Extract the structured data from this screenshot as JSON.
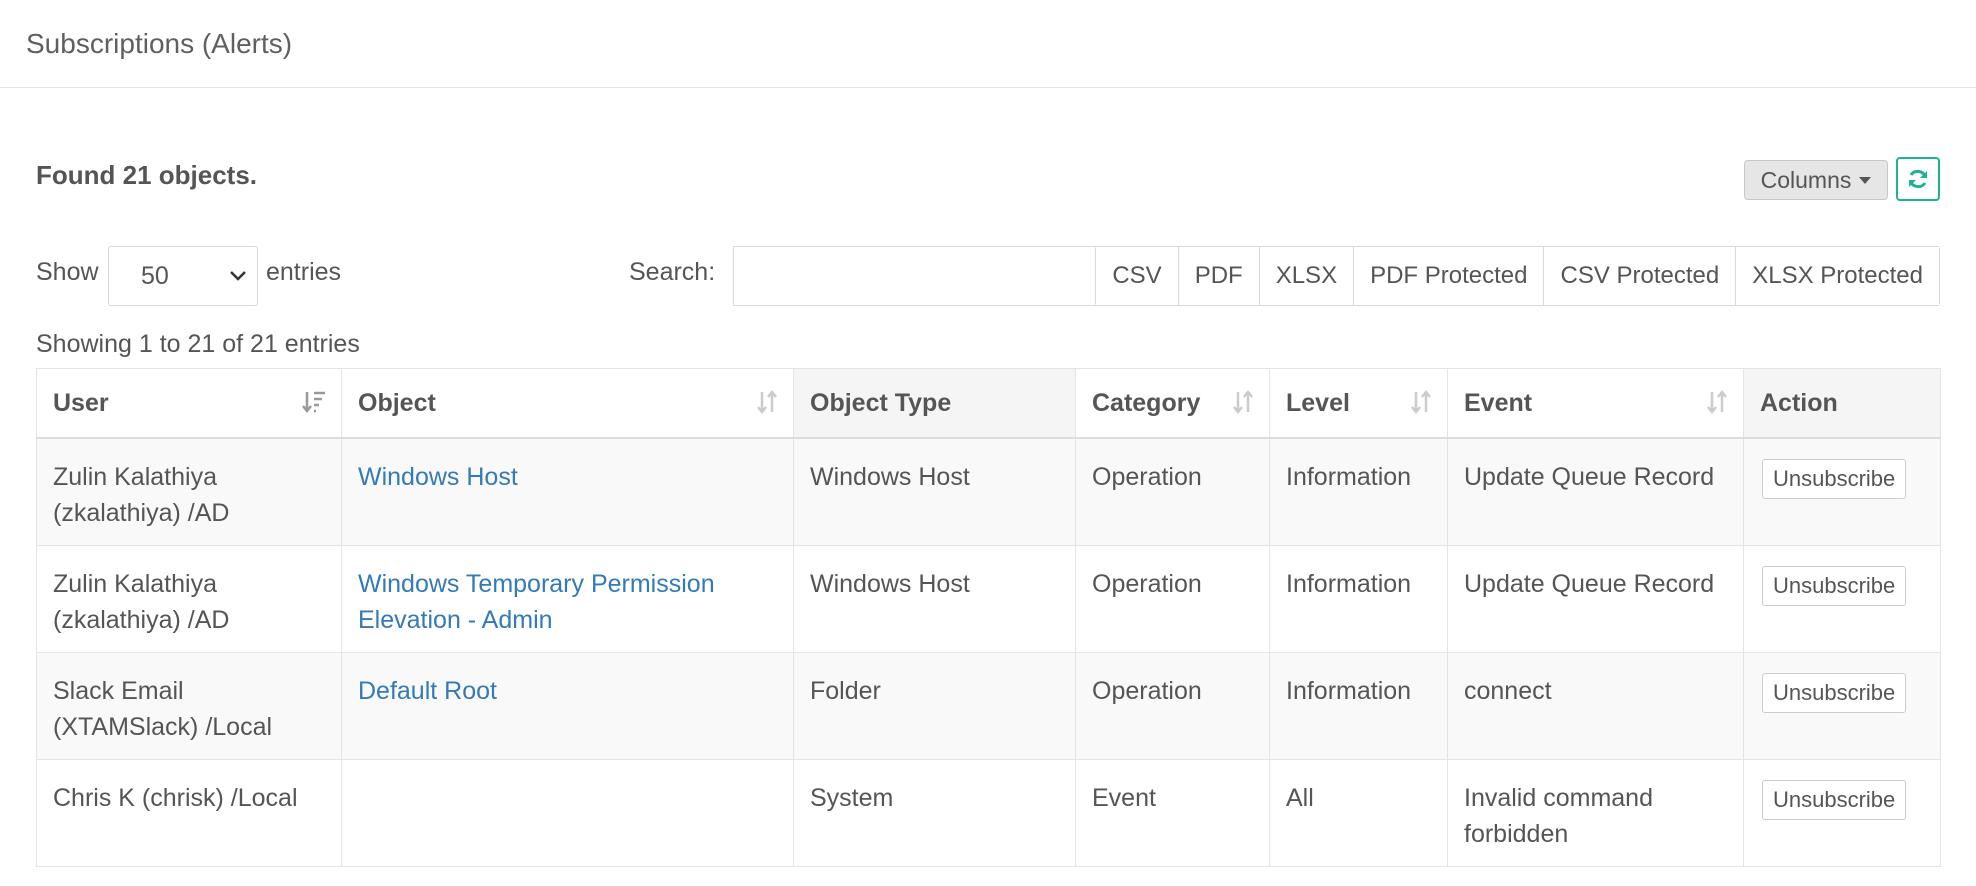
{
  "page": {
    "title": "Subscriptions (Alerts)"
  },
  "summary": {
    "found_text": "Found 21 objects."
  },
  "toolbar": {
    "columns_label": "Columns",
    "refresh_icon": "refresh-icon",
    "accent": "#1ab394"
  },
  "length_menu": {
    "show_label": "Show",
    "selected": "50",
    "entries_label": "entries"
  },
  "search": {
    "label": "Search:",
    "value": "",
    "placeholder": ""
  },
  "export_buttons": [
    "CSV",
    "PDF",
    "XLSX",
    "PDF Protected",
    "CSV Protected",
    "XLSX Protected"
  ],
  "info_text": "Showing 1 to 21 of 21 entries",
  "table": {
    "headers": [
      "User",
      "Object",
      "Object Type",
      "Category",
      "Level",
      "Event",
      "Action"
    ],
    "rows": [
      {
        "user": "Zulin Kalathiya (zkalathiya) /AD",
        "object": "Windows Host",
        "object_type": "Windows Host",
        "category": "Operation",
        "level": "Information",
        "event": "Update Queue Record",
        "action": "Unsubscribe"
      },
      {
        "user": "Zulin Kalathiya (zkalathiya) /AD",
        "object": "Windows Temporary Permission Elevation - Admin",
        "object_type": "Windows Host",
        "category": "Operation",
        "level": "Information",
        "event": "Update Queue Record",
        "action": "Unsubscribe"
      },
      {
        "user": "Slack Email (XTAMSlack) /Local",
        "object": "Default Root",
        "object_type": "Folder",
        "category": "Operation",
        "level": "Information",
        "event": "connect",
        "action": "Unsubscribe"
      },
      {
        "user": "Chris K (chrisk) /Local",
        "object": "",
        "object_type": "System",
        "category": "Event",
        "level": "All",
        "event": "Invalid command forbidden",
        "action": "Unsubscribe"
      }
    ]
  },
  "colors": {
    "link": "#337ab7",
    "text": "#555555",
    "border": "#e4e4e4",
    "stripe": "#f9f9f9"
  }
}
